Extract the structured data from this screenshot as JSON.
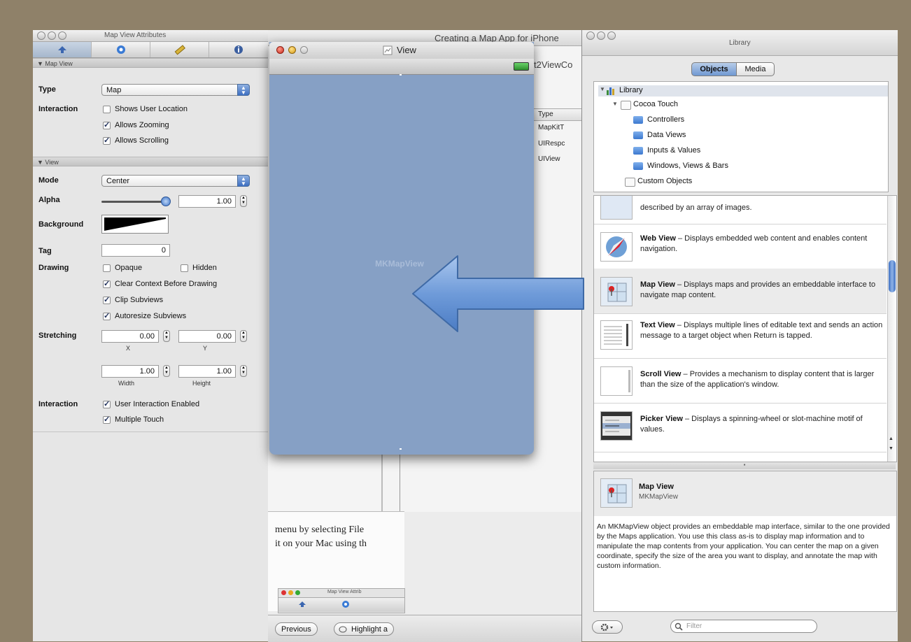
{
  "inspector": {
    "title": "Map View Attributes",
    "tabs": [
      {
        "icon": "attributes-icon"
      },
      {
        "icon": "connections-icon"
      },
      {
        "icon": "size-icon"
      },
      {
        "icon": "identity-icon"
      }
    ],
    "map_section": {
      "header": "▼ Map View",
      "type_label": "Type",
      "type_value": "Map",
      "interaction_label": "Interaction",
      "shows_user_location": "Shows User Location",
      "allows_zooming": "Allows Zooming",
      "allows_scrolling": "Allows Scrolling"
    },
    "view_section": {
      "header": "▼ View",
      "mode_label": "Mode",
      "mode_value": "Center",
      "alpha_label": "Alpha",
      "alpha_value": "1.00",
      "background_label": "Background",
      "tag_label": "Tag",
      "tag_value": "0",
      "drawing_label": "Drawing",
      "opaque": "Opaque",
      "hidden": "Hidden",
      "clear_context": "Clear Context Before Drawing",
      "clip_subviews": "Clip Subviews",
      "autoresize": "Autoresize Subviews",
      "stretching_label": "Stretching",
      "x_value": "0.00",
      "x_label": "X",
      "y_value": "0.00",
      "y_label": "Y",
      "width_value": "1.00",
      "width_label": "Width",
      "height_value": "1.00",
      "height_label": "Height",
      "interaction_label": "Interaction",
      "user_interaction": "User Interaction Enabled",
      "multiple_touch": "Multiple Touch"
    }
  },
  "document": {
    "title": "Creating a Map App for iPhone",
    "header_fragment": "t2ViewCo",
    "type_header": "Type",
    "type_rows": [
      "MapKitT",
      "UIRespc",
      "UIView"
    ],
    "page_text_1": "menu by selecting File",
    "page_text_2": "it on your Mac using th",
    "thumb_title": "Map View Attrib",
    "previous_button": "Previous",
    "highlight_button": "Highlight a"
  },
  "view_window": {
    "title": "View",
    "map_label": "MKMapView"
  },
  "library": {
    "title": "Library",
    "seg_objects": "Objects",
    "seg_media": "Media",
    "tree": [
      {
        "label": "Library",
        "level": 0
      },
      {
        "label": "Cocoa Touch",
        "level": 1
      },
      {
        "label": "Controllers",
        "level": 2
      },
      {
        "label": "Data Views",
        "level": 2
      },
      {
        "label": "Inputs & Values",
        "level": 2
      },
      {
        "label": "Windows, Views & Bars",
        "level": 2
      },
      {
        "label": "Custom Objects",
        "level": 1
      }
    ],
    "objects": [
      {
        "name": "",
        "desc": "described by an array of images.",
        "icon": "image-view-icon"
      },
      {
        "name": "Web View",
        "desc": " – Displays embedded web content and enables content navigation.",
        "icon": "web-view-icon"
      },
      {
        "name": "Map View",
        "desc": " – Displays maps and provides an embeddable interface to navigate map content.",
        "icon": "map-view-icon"
      },
      {
        "name": "Text View",
        "desc": " – Displays multiple lines of editable text and sends an action message to a target object when Return is tapped.",
        "icon": "text-view-icon"
      },
      {
        "name": "Scroll View",
        "desc": " – Provides a mechanism to display content that is larger than the size of the application's window.",
        "icon": "scroll-view-icon"
      },
      {
        "name": "Picker View",
        "desc": " – Displays a spinning-wheel or slot-machine motif of values.",
        "icon": "picker-view-icon"
      }
    ],
    "detail": {
      "title": "Map View",
      "class": "MKMapView",
      "description": "An MKMapView object provides an embeddable map interface, similar to the one provided by the Maps application. You use this class as-is to display map information and to manipulate the map contents from your application. You can center the map on a given coordinate, specify the size of the area you want to display, and annotate the map with custom information."
    },
    "filter_placeholder": "Filter"
  }
}
